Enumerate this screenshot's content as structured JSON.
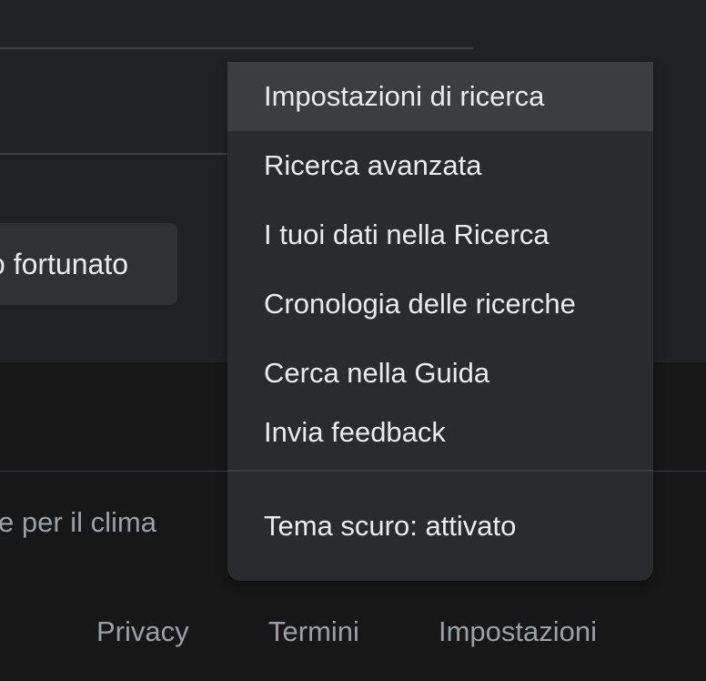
{
  "main": {
    "lucky_button_label": "o fortunato"
  },
  "menu": {
    "items": [
      {
        "label": "Impostazioni di ricerca"
      },
      {
        "label": "Ricerca avanzata"
      },
      {
        "label": "I tuoi dati nella Ricerca"
      },
      {
        "label": "Cronologia delle ricerche"
      },
      {
        "label": "Cerca nella Guida"
      },
      {
        "label": "Invia feedback"
      }
    ],
    "dark_theme_label": "Tema scuro: attivato"
  },
  "footer": {
    "climate_link": "e per il clima",
    "links": [
      "Privacy",
      "Termini",
      "Impostazioni"
    ]
  },
  "colors": {
    "background": "#202124",
    "footer_background": "#171717",
    "menu_background": "#2a2b2e",
    "menu_highlight": "#3c3d40",
    "text_primary": "#e8eaed",
    "text_secondary": "#9aa0a6"
  }
}
